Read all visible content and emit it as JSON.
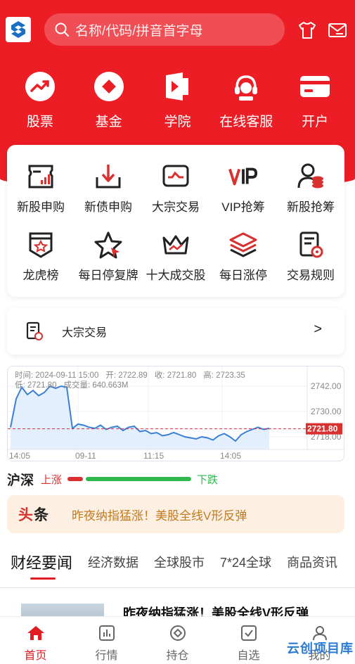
{
  "search": {
    "placeholder": "名称/代码/拼音首字母"
  },
  "quick_nav": [
    {
      "label": "股票",
      "icon": "trend-up-icon"
    },
    {
      "label": "基金",
      "icon": "diamond-icon"
    },
    {
      "label": "学院",
      "icon": "video-play-icon"
    },
    {
      "label": "在线客服",
      "icon": "headset-icon"
    },
    {
      "label": "开户",
      "icon": "card-icon"
    }
  ],
  "services": [
    {
      "label": "新股申购",
      "icon": "new-stock-icon"
    },
    {
      "label": "新债申购",
      "icon": "new-bond-icon"
    },
    {
      "label": "大宗交易",
      "icon": "block-trade-icon"
    },
    {
      "label": "VIP抢筹",
      "icon": "vip-icon"
    },
    {
      "label": "新股抢筹",
      "icon": "user-coins-icon"
    },
    {
      "label": "龙虎榜",
      "icon": "shield-star-icon"
    },
    {
      "label": "每日停复牌",
      "icon": "star-cursor-icon"
    },
    {
      "label": "十大成交股",
      "icon": "crown-icon"
    },
    {
      "label": "每日涨停",
      "icon": "layers-icon"
    },
    {
      "label": "交易规则",
      "icon": "rules-doc-icon"
    }
  ],
  "block_trade": {
    "title": "大宗交易",
    "arrow": ">"
  },
  "index_chart": {
    "time": "时间: 2024-09-11 15:00",
    "open": "开: 2722.89",
    "close": "收: 2721.80",
    "high": "高: 2723.35",
    "low": "低: 2721.80",
    "volume": "成交量: 640.663M",
    "current_label": "2721.80"
  },
  "chart_data": {
    "type": "area",
    "x_ticks": [
      "14:05",
      "09-11",
      "11:15",
      "14:05"
    ],
    "y_ticks": [
      "2742.00",
      "2730.00",
      "2718.00"
    ],
    "ylim": [
      2714,
      2748
    ],
    "reference_value": 2721.8,
    "values": [
      2722.5,
      2736.0,
      2741.5,
      2738.0,
      2740.0,
      2737.5,
      2739.0,
      2742.0,
      2741.0,
      2742.0,
      2741.5,
      2722.0,
      2724.0,
      2723.5,
      2722.5,
      2722.0,
      2723.5,
      2721.5,
      2722.5,
      2723.0,
      2721.0,
      2722.5,
      2723.0,
      2720.5,
      2721.0,
      2719.5,
      2720.0,
      2718.5,
      2719.0,
      2720.0,
      2719.0,
      2718.0,
      2717.5,
      2717.0,
      2718.0,
      2717.5,
      2716.5,
      2718.5,
      2719.5,
      2718.0,
      2716.0,
      2719.0,
      2720.5,
      2721.5,
      2722.5,
      2721.5,
      2722.0
    ],
    "line_color": "#3a7fd5",
    "fill_color": "#dcebfb",
    "reference_color": "#d93030"
  },
  "market": {
    "name": "沪深",
    "up_label": "上涨",
    "down_label": "下跌",
    "up_ratio": 0.13,
    "up_color": "#d93030",
    "down_color": "#2eb84f"
  },
  "headline": {
    "tag_left": "头",
    "tag_right": "条",
    "text": "昨夜纳指猛涨！美股全线V形反弹"
  },
  "news_tabs": [
    "财经要闻",
    "经济数据",
    "全球股市",
    "7*24全球",
    "商品资讯"
  ],
  "article": {
    "title": "昨夜纳指猛涨！美股全线V形反弹"
  },
  "bottom_nav": [
    {
      "label": "首页",
      "icon": "home-icon",
      "active": true
    },
    {
      "label": "行情",
      "icon": "chart-icon"
    },
    {
      "label": "持仓",
      "icon": "position-icon"
    },
    {
      "label": "自选",
      "icon": "checkbox-icon"
    },
    {
      "label": "我的",
      "icon": "user-icon"
    }
  ],
  "watermark": "云创项目库",
  "colors": {
    "brand_red": "#ec1d24",
    "active_red": "#e21b22"
  }
}
